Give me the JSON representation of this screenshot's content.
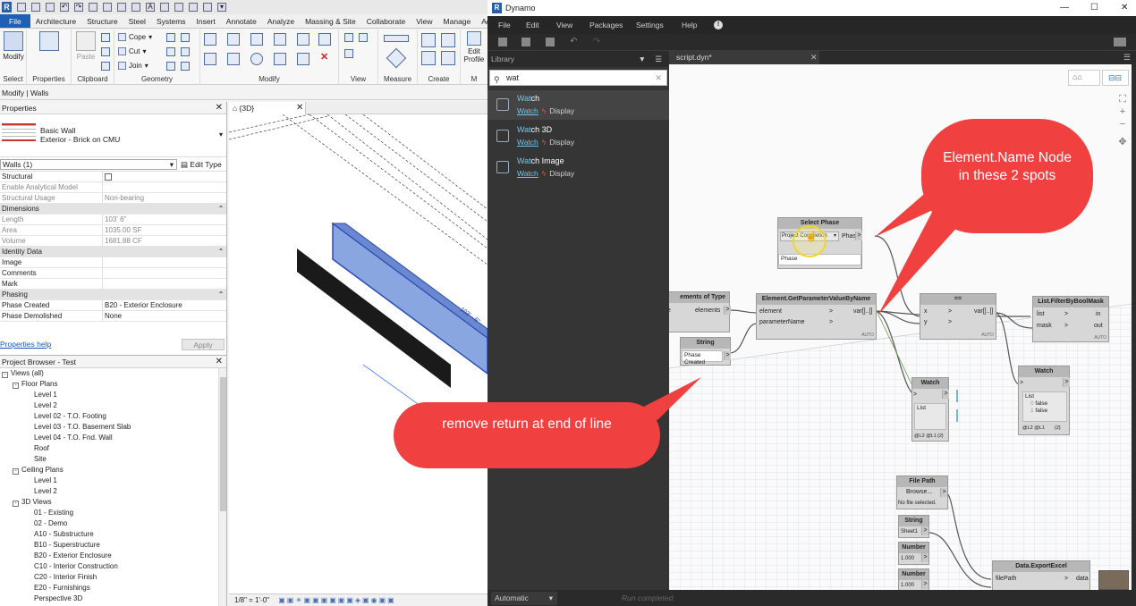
{
  "revit": {
    "ribbon_tabs": [
      "File",
      "Architecture",
      "Structure",
      "Steel",
      "Systems",
      "Insert",
      "Annotate",
      "Analyze",
      "Massing & Site",
      "Collaborate",
      "View",
      "Manage",
      "Add-In"
    ],
    "modify_label": "Modify",
    "paste_label": "Paste",
    "cope_label": "Cope",
    "cut_label": "Cut",
    "join_label": "Join",
    "edit_profile_label": "Edit Profile",
    "group_select": "Select",
    "group_properties": "Properties",
    "group_clipboard": "Clipboard",
    "group_geometry": "Geometry",
    "group_modify": "Modify",
    "group_view": "View",
    "group_measure": "Measure",
    "group_create": "Create",
    "group_mode": "M",
    "context_bar": "Modify | Walls",
    "properties": {
      "title": "Properties",
      "type_family": "Basic Wall",
      "type_name": "Exterior - Brick on CMU",
      "instance_filter": "Walls (1)",
      "edit_type": "Edit Type",
      "rows": [
        {
          "kind": "row",
          "name": "Structural",
          "value": "",
          "checkbox": true
        },
        {
          "kind": "row",
          "name": "Enable Analytical Model",
          "value": "",
          "grey": true
        },
        {
          "kind": "row",
          "name": "Structural Usage",
          "value": "Non-bearing",
          "grey": true
        },
        {
          "kind": "cat",
          "name": "Dimensions"
        },
        {
          "kind": "row",
          "name": "Length",
          "value": "103'  6\"",
          "grey": true
        },
        {
          "kind": "row",
          "name": "Area",
          "value": "1035.00 SF",
          "grey": true
        },
        {
          "kind": "row",
          "name": "Volume",
          "value": "1681.88 CF",
          "grey": true
        },
        {
          "kind": "cat",
          "name": "Identity Data"
        },
        {
          "kind": "row",
          "name": "Image",
          "value": ""
        },
        {
          "kind": "row",
          "name": "Comments",
          "value": ""
        },
        {
          "kind": "row",
          "name": "Mark",
          "value": ""
        },
        {
          "kind": "cat",
          "name": "Phasing"
        },
        {
          "kind": "row",
          "name": "Phase Created",
          "value": "B20 - Exterior Enclosure"
        },
        {
          "kind": "row",
          "name": "Phase Demolished",
          "value": "None"
        }
      ],
      "help_link": "Properties help",
      "apply": "Apply"
    },
    "browser": {
      "title": "Project Browser - Test",
      "items": [
        {
          "label": "Views (all)",
          "level": 0,
          "expander": "-"
        },
        {
          "label": "Floor Plans",
          "level": 1,
          "expander": "-"
        },
        {
          "label": "Level 1",
          "level": 2
        },
        {
          "label": "Level 2",
          "level": 2
        },
        {
          "label": "Level 02 - T.O. Footing",
          "level": 2
        },
        {
          "label": "Level 03 - T.O. Basement Slab",
          "level": 2
        },
        {
          "label": "Level 04 - T.O. Fnd. Wall",
          "level": 2
        },
        {
          "label": "Roof",
          "level": 2
        },
        {
          "label": "Site",
          "level": 2
        },
        {
          "label": "Ceiling Plans",
          "level": 1,
          "expander": "-"
        },
        {
          "label": "Level 1",
          "level": 2
        },
        {
          "label": "Level 2",
          "level": 2
        },
        {
          "label": "3D Views",
          "level": 1,
          "expander": "-"
        },
        {
          "label": "01 - Existing",
          "level": 2
        },
        {
          "label": "02 - Demo",
          "level": 2
        },
        {
          "label": "A10 - Substructure",
          "level": 2
        },
        {
          "label": "B10 - Superstructure",
          "level": 2
        },
        {
          "label": "B20 - Exterior Enclosure",
          "level": 2
        },
        {
          "label": "C10 - Interior Construction",
          "level": 2
        },
        {
          "label": "C20 - Interior Finish",
          "level": 2
        },
        {
          "label": "E20 - Furnishings",
          "level": 2
        },
        {
          "label": "Perspective 3D",
          "level": 2
        }
      ]
    },
    "view_tab": "{3D}",
    "view_scale": "1/8\" = 1'-0\"",
    "dim_text": "103' - 6\""
  },
  "dynamo": {
    "title": "Dynamo",
    "menu": [
      "File",
      "Edit",
      "View",
      "Packages",
      "Settings",
      "Help"
    ],
    "library_title": "Library",
    "search_value": "wat",
    "results": [
      {
        "match": "Wat",
        "rest": "ch",
        "sub": "Watch",
        "category": "Display"
      },
      {
        "match": "Wat",
        "rest": "ch 3D",
        "sub": "Watch",
        "category": "Display"
      },
      {
        "match": "Wat",
        "rest": "ch Image",
        "sub": "Watch",
        "category": "Display"
      }
    ],
    "tab": "script.dyn*",
    "status_mode": "Automatic",
    "status_text": "Run completed.",
    "nodes": {
      "select_phase": {
        "title": "Select Phase",
        "dropdown": "Project Completion",
        "out": "Phase",
        "preview": "Phase"
      },
      "elements_of_type": {
        "title": "ements of Type",
        "out": "elements"
      },
      "string1": {
        "title": "String",
        "value": "Phase Created"
      },
      "getparam": {
        "title": "Element.GetParameterValueByName",
        "in1": "element",
        "in2": "parameterName",
        "out": "var[]..[]",
        "auto": "AUTO"
      },
      "equals": {
        "title": "==",
        "in1": "x",
        "in2": "y",
        "out": "var[]..[]",
        "auto": "AUTO"
      },
      "filter": {
        "title": "List.FilterByBoolMask",
        "in1": "list",
        "in2": "mask",
        "out1": "in",
        "out2": "out",
        "auto": "AUTO"
      },
      "watch1": {
        "title": "Watch",
        "list": "List",
        "foot": "@L2 @L1",
        "count": "{2}"
      },
      "watch2": {
        "title": "Watch",
        "list": "List",
        "v1": "false",
        "v2": "false",
        "foot": "@L2 @L1",
        "count": "{2}"
      },
      "filepath": {
        "title": "File Path",
        "button": "Browse...",
        "status": "No file selected."
      },
      "string2": {
        "title": "String",
        "value": "Sheet1"
      },
      "number1": {
        "title": "Number",
        "value": "1.000"
      },
      "number2": {
        "title": "Number",
        "value": "1.000"
      },
      "export": {
        "title": "Data.ExportExcel",
        "in1": "filePath",
        "out": "data"
      }
    },
    "callout_top": "Element.Name Node in these 2 spots",
    "callout_bottom": "remove return at end of line"
  }
}
